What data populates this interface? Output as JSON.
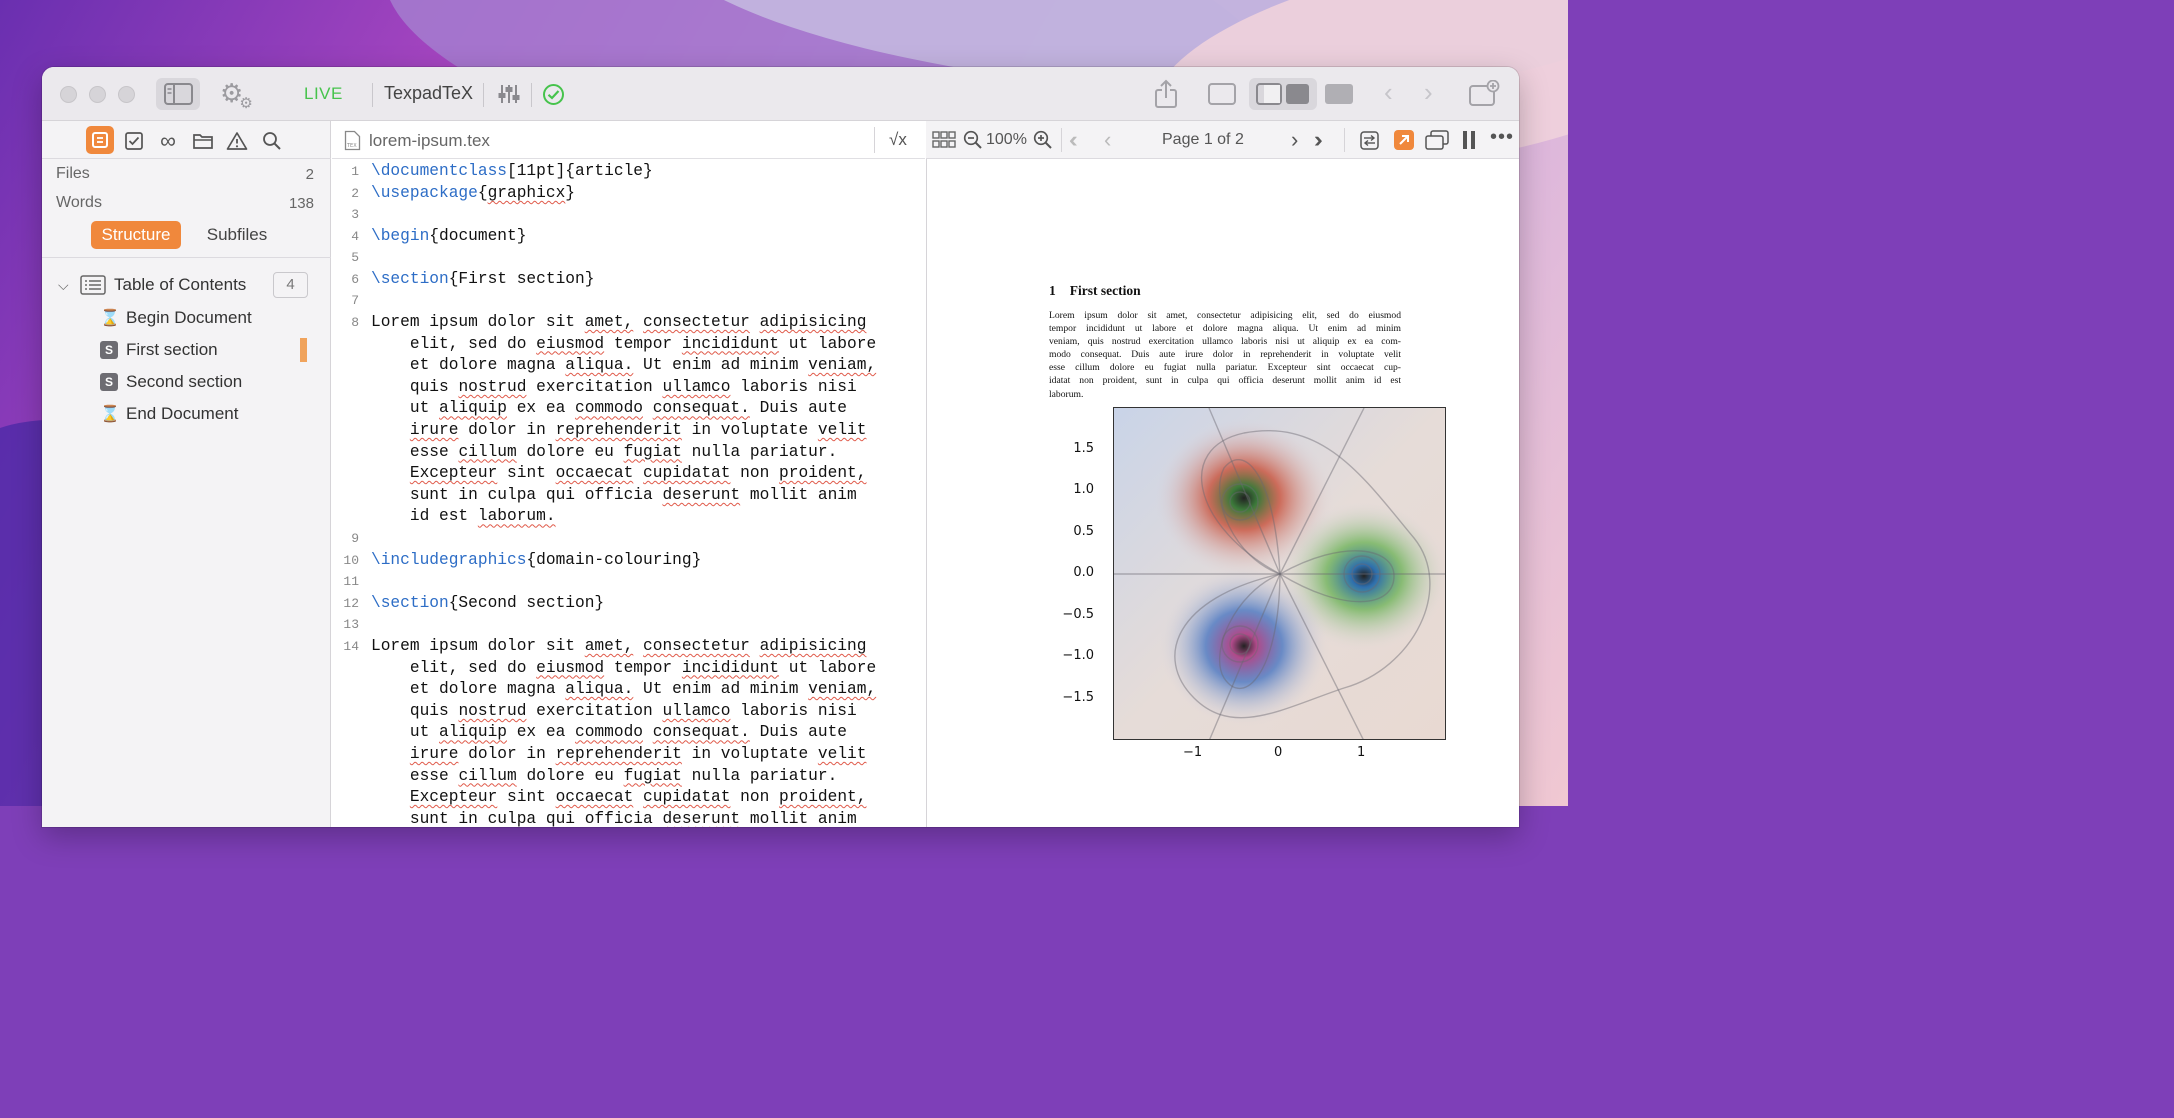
{
  "toolbar": {
    "live_label": "LIVE",
    "engine_label": "TexpadTeX"
  },
  "sidebar": {
    "stats": [
      {
        "label": "Files",
        "value": "2"
      },
      {
        "label": "Words",
        "value": "138"
      }
    ],
    "tabs": [
      {
        "label": "Structure",
        "active": true
      },
      {
        "label": "Subfiles",
        "active": false
      }
    ],
    "toc": {
      "title": "Table of Contents",
      "count": "4",
      "items": [
        {
          "label": "Begin Document",
          "icon": "hourglass-icon"
        },
        {
          "label": "First section",
          "icon": "section-icon",
          "badge": "S",
          "current": true
        },
        {
          "label": "Second section",
          "icon": "section-icon",
          "badge": "S"
        },
        {
          "label": "End Document",
          "icon": "hourglass-icon"
        }
      ]
    }
  },
  "editor": {
    "filename": "lorem-ipsum.tex",
    "math_button": "√x",
    "line_numbers": [
      "1",
      "2",
      "3",
      "4",
      "5",
      "6",
      "7",
      "8",
      "9",
      "10",
      "11",
      "12",
      "13",
      "14"
    ],
    "lines": {
      "l1_cmd": "\\documentclass",
      "l1_rest": "[11pt]{article}",
      "l2_cmd": "\\usepackage",
      "l2_a": "{",
      "l2_word": "graphicx",
      "l2_b": "}",
      "l4_cmd": "\\begin",
      "l4_rest": "{document}",
      "l6_cmd": "\\section",
      "l6_rest": "{First section}",
      "l10_cmd": "\\includegraphics",
      "l10_rest": "{domain-colouring}",
      "l12_cmd": "\\section",
      "l12_rest": "{Second section}"
    },
    "lorem_lines": [
      "Lorem ipsum dolor sit amet, consectetur adipisicing",
      "    elit, sed do eiusmod tempor incididunt ut labore",
      "    et dolore magna aliqua. Ut enim ad minim veniam,",
      "    quis nostrud exercitation ullamco laboris nisi",
      "    ut aliquip ex ea commodo consequat. Duis aute",
      "    irure dolor in reprehenderit in voluptate velit",
      "    esse cillum dolore eu fugiat nulla pariatur.",
      "    Excepteur sint occaecat cupidatat non proident,",
      "    sunt in culpa qui officia deserunt mollit anim",
      "    id est laborum."
    ]
  },
  "pdf": {
    "zoom": "100%",
    "page_label": "Page 1 of 2",
    "section_number": "1",
    "section_title": "First section",
    "paragraph_lines": [
      "Lorem ipsum dolor sit amet, consectetur adipisicing elit, sed do eiusmod",
      "tempor incididunt ut labore et dolore magna aliqua.  Ut enim ad minim",
      "veniam, quis nostrud exercitation ullamco laboris nisi ut aliquip ex ea com-",
      "modo consequat.  Duis aute irure dolor in reprehenderit in voluptate velit",
      "esse cillum dolore eu fugiat nulla pariatur.  Excepteur sint occaecat cup-",
      "idatat non proident, sunt in culpa qui officia deserunt mollit anim id est",
      "laborum."
    ],
    "plot": {
      "y_ticks": [
        "1.5",
        "1.0",
        "0.5",
        "0.0",
        "−0.5",
        "−1.0",
        "−1.5"
      ],
      "x_ticks": [
        "−1",
        "0",
        "1"
      ]
    }
  },
  "colors": {
    "accent": "#f0883c",
    "live": "#46c34c",
    "keyword": "#2d6dc6",
    "spell": "#e05a4a"
  }
}
